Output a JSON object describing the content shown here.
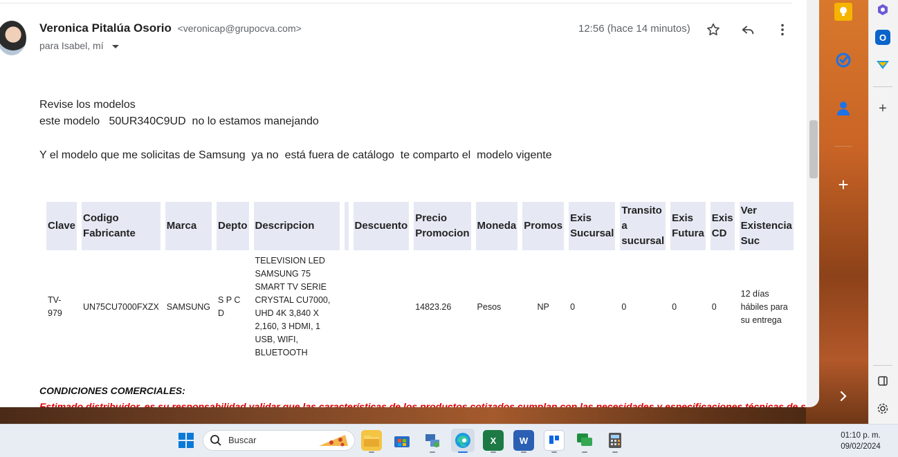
{
  "message": {
    "sender_name": "Veronica Pitalúa Osorio",
    "sender_email": "<veronicap@grupocva.com>",
    "recipients": "para Isabel, mí",
    "time": "12:56 (hace 14 minutos)"
  },
  "body": {
    "line1": "Revise los modelos",
    "line2": "este modelo   50UR340C9UD  no lo estamos manejando",
    "line3": "Y el modelo que me solicitas de Samsung  ya no  está fuera de catálogo  te comparto el  modelo vigente"
  },
  "table": {
    "headers": {
      "clave": "Clave",
      "codigo": "Codigo Fabricante",
      "marca": "Marca",
      "depto": "Depto",
      "descripcion": "Descripcion",
      "descuento": "Descuento",
      "precio": "Precio Promocion",
      "moneda": "Moneda",
      "promos": "Promos",
      "exis_suc": "Exis Sucursal",
      "transito": "Transito a sucursal",
      "exis_futura": "Exis Futura",
      "exis_cd": "Exis CD",
      "ver_exist": "Ver Existencia Suc"
    },
    "row": {
      "clave": "TV-979",
      "codigo": "UN75CU7000FXZX",
      "marca": "SAMSUNG",
      "depto": "S P C D",
      "descripcion": "TELEVISION LED SAMSUNG 75 SMART TV SERIE CRYSTAL CU7000, UHD 4K 3,840 X 2,160, 3 HDMI, 1 USB, WIFI, BLUETOOTH",
      "descuento": "",
      "precio": "14823.26",
      "moneda": "Pesos",
      "promos": "NP",
      "exis_suc": "0",
      "transito": "0",
      "exis_futura": "0",
      "exis_cd": "0",
      "ver_exist": "12 días hábiles  para su entrega"
    }
  },
  "conditions": {
    "title": "CONDICIONES COMERCIALES:",
    "text": "Estimado distribuidor, es su responsabilidad validar que las características de los productos cotizados cumplan con las necesidades y especificaciones técnicas de su"
  },
  "taskbar": {
    "search_placeholder": "Buscar",
    "time": "01:10 p. m.",
    "date": "09/02/2024"
  },
  "colors": {
    "header_bg": "#e6e9f4",
    "alert_red": "#e00000",
    "gmail_blue": "#1a73e8"
  }
}
